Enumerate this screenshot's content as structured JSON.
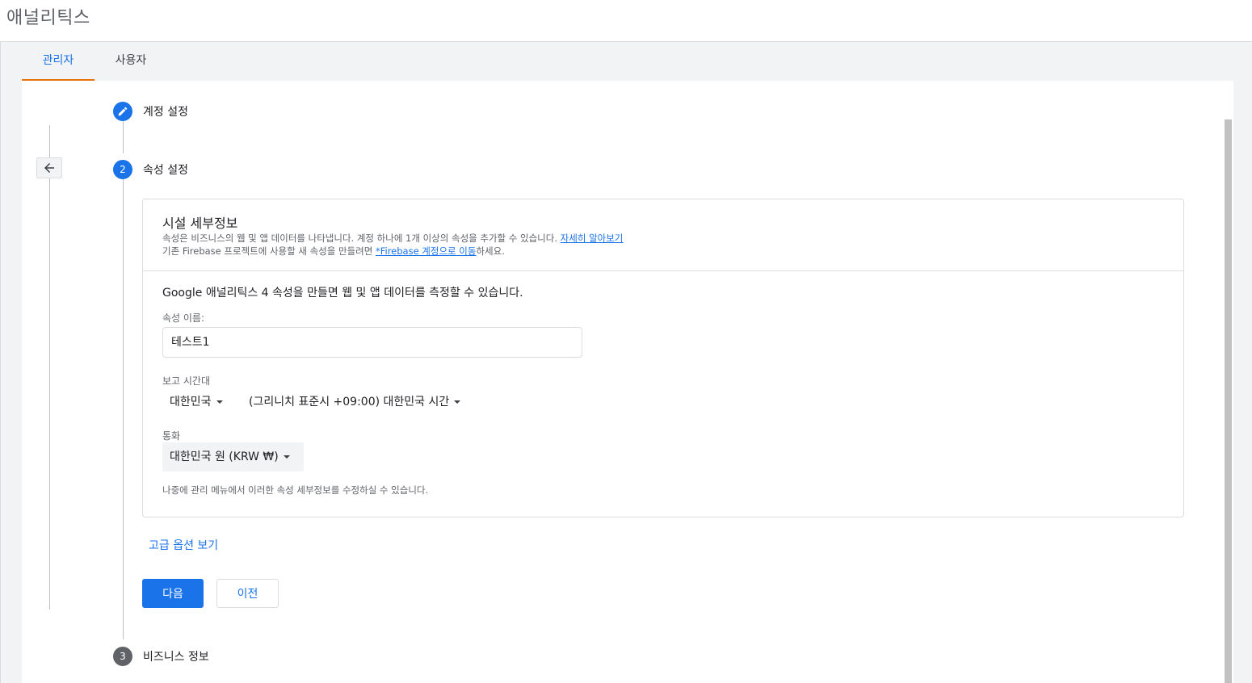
{
  "app": {
    "title": "애널리틱스"
  },
  "tabs": [
    {
      "label": "관리자",
      "active": true
    },
    {
      "label": "사용자",
      "active": false
    }
  ],
  "steps": [
    {
      "number": "",
      "icon": "pencil-icon",
      "label": "계정 설정",
      "state": "completed"
    },
    {
      "number": "2",
      "label": "속성 설정",
      "state": "active"
    },
    {
      "number": "3",
      "label": "비즈니스 정보",
      "state": "pending"
    }
  ],
  "property": {
    "heading": "시설 세부정보",
    "desc1": "속성은 비즈니스의 웹 및 앱 데이터를 나타냅니다. 계정 하나에 1개 이상의 속성을 추가할 수 있습니다.",
    "learn_more": "자세히 알아보기",
    "desc2_prefix": "기존 Firebase 프로젝트에 사용할 새 속성을 만들려면 ",
    "firebase_link": "*Firebase 계정으로 이동",
    "desc2_suffix": "하세요.",
    "intro": "Google 애널리틱스 4 속성을 만들면 웹 및 앱 데이터를 측정할 수 있습니다.",
    "name_label": "속성 이름:",
    "name_value": "테스트1",
    "timezone_label": "보고 시간대",
    "country": "대한민국",
    "timezone": "(그리니치 표준시 +09:00) 대한민국 시간",
    "currency_label": "통화",
    "currency": "대한민국 원 (KRW ₩)",
    "note": "나중에 관리 메뉴에서 이러한 속성 세부정보를 수정하실 수 있습니다."
  },
  "actions": {
    "advanced": "고급 옵션 보기",
    "next": "다음",
    "prev": "이전"
  },
  "colors": {
    "accent": "#1a73e8",
    "tab_indicator": "#e8710a",
    "pending_step": "#5f6368"
  }
}
